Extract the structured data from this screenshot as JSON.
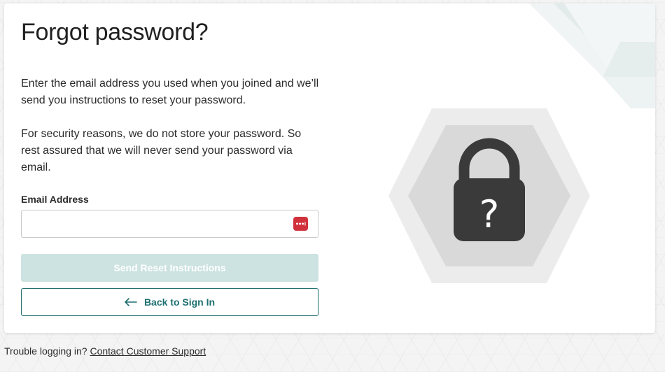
{
  "page": {
    "title": "Forgot password?",
    "intro": "Enter the email address you used when you joined and we’ll send you instructions to reset your password.",
    "security_note": "For security reasons, we do not store your password. So rest assured that we will never send your password via email."
  },
  "form": {
    "email_label": "Email Address",
    "email_value": "",
    "email_placeholder": "",
    "password_manager_icon": "password-manager-icon"
  },
  "buttons": {
    "send_label": "Send Reset Instructions",
    "back_label": "Back to Sign In"
  },
  "illustration": {
    "icon": "padlock-question-icon",
    "glyph": "?"
  },
  "footer": {
    "prefix": "Trouble logging in?",
    "link": "Contact Customer Support"
  },
  "colors": {
    "accent": "#1e6f70",
    "send_disabled_bg": "#cde3e1",
    "password_manager_red": "#d0313b",
    "lock_dark": "#3a3a3a",
    "hex_outer": "#ececec",
    "hex_inner": "#d9d9d9"
  }
}
